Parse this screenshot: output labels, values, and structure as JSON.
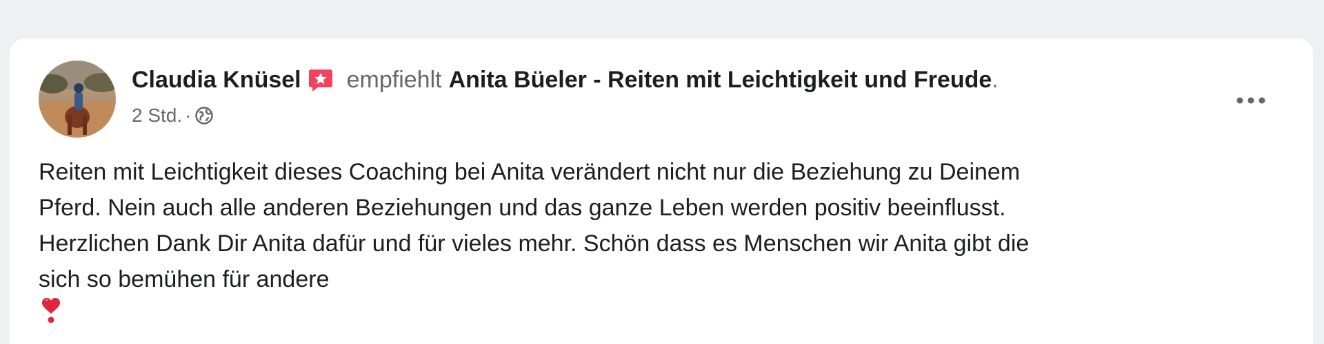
{
  "post": {
    "author_name": "Claudia Knüsel",
    "recommend_verb": "empfiehlt",
    "page_name": "Anita Büeler - Reiten mit Leichtigkeit und Freude",
    "period": ".",
    "time": "2 Std.",
    "meta_separator": "·",
    "privacy_icon": "globe-icon",
    "badge_icon": "recommendation-star-icon",
    "more_icon": "more-options-icon",
    "body_lines": [
      "Reiten mit Leichtigkeit dieses Coaching bei Anita verändert nicht nur die Beziehung zu Deinem",
      "Pferd. Nein auch alle anderen Beziehungen und das ganze Leben werden positiv beeinflusst.",
      "Herzlichen Dank Dir Anita dafür und für vieles mehr. Schön dass es Menschen wir Anita gibt die",
      "sich so bemühen für andere"
    ],
    "trailing_emoji": "heart-exclamation-icon"
  },
  "colors": {
    "page_background": "#eef0f4",
    "card_background": "#ffffff",
    "primary_text": "#1c1e21",
    "secondary_text": "#65676b",
    "badge_color": "#f3425f",
    "heart_color": "#e0263f"
  }
}
